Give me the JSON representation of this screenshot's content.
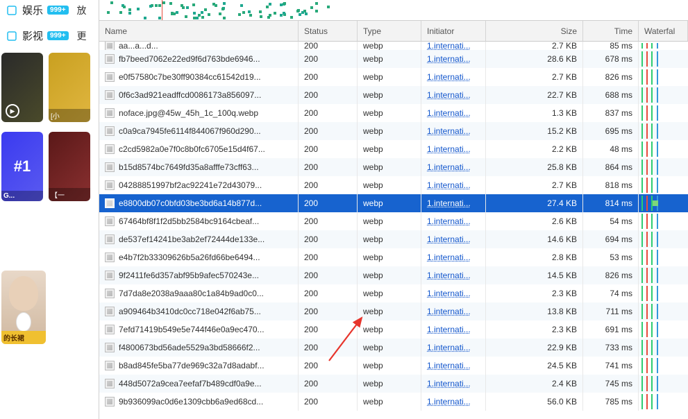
{
  "sidebar": {
    "items": [
      {
        "icon": "entertainment-icon",
        "label": "娱乐",
        "badge": "999+",
        "trail": "放"
      },
      {
        "icon": "film-icon",
        "label": "影视",
        "badge": "999+",
        "trail": "更"
      }
    ],
    "thumbs_row1": [
      {
        "kind": "dark",
        "play": true
      },
      {
        "kind": "yellow",
        "cap": "[小"
      }
    ],
    "thumbs_row2": [
      {
        "kind": "blue",
        "text": "#1",
        "cap": "G..."
      },
      {
        "kind": "red",
        "cap": "【一"
      }
    ],
    "thumb_person": {
      "cap": "的长裙"
    }
  },
  "headers": {
    "name": "Name",
    "status": "Status",
    "type": "Type",
    "initiator": "Initiator",
    "size": "Size",
    "time": "Time",
    "waterfall": "Waterfal"
  },
  "rows": [
    {
      "name": "aa...a...d...",
      "status": "200",
      "type": "webp",
      "initiator": "1.internati...",
      "size": "2.7 KB",
      "time": "85 ms",
      "sel": false,
      "partial": true
    },
    {
      "name": "fb7beed7062e22ed9f6d763bde6946...",
      "status": "200",
      "type": "webp",
      "initiator": "1.internati...",
      "size": "28.6 KB",
      "time": "678 ms",
      "sel": false
    },
    {
      "name": "e0f57580c7be30ff90384cc61542d19...",
      "status": "200",
      "type": "webp",
      "initiator": "1.internati...",
      "size": "2.7 KB",
      "time": "826 ms",
      "sel": false
    },
    {
      "name": "0f6c3ad921eadffcd0086173a856097...",
      "status": "200",
      "type": "webp",
      "initiator": "1.internati...",
      "size": "22.7 KB",
      "time": "688 ms",
      "sel": false
    },
    {
      "name": "noface.jpg@45w_45h_1c_100q.webp",
      "status": "200",
      "type": "webp",
      "initiator": "1.internati...",
      "size": "1.3 KB",
      "time": "837 ms",
      "sel": false
    },
    {
      "name": "c0a9ca7945fe6114f844067f960d290...",
      "status": "200",
      "type": "webp",
      "initiator": "1.internati...",
      "size": "15.2 KB",
      "time": "695 ms",
      "sel": false
    },
    {
      "name": "c2cd5982a0e7f0c8b0fc6705e15d4f67...",
      "status": "200",
      "type": "webp",
      "initiator": "1.internati...",
      "size": "2.2 KB",
      "time": "48 ms",
      "sel": false
    },
    {
      "name": "b15d8574bc7649fd35a8afffe73cff63...",
      "status": "200",
      "type": "webp",
      "initiator": "1.internati...",
      "size": "25.8 KB",
      "time": "864 ms",
      "sel": false
    },
    {
      "name": "04288851997bf2ac92241e72d43079...",
      "status": "200",
      "type": "webp",
      "initiator": "1.internati...",
      "size": "2.7 KB",
      "time": "818 ms",
      "sel": false
    },
    {
      "name": "e8800db07c0bfd03be3bd6a14b877d...",
      "status": "200",
      "type": "webp",
      "initiator": "1.internati...",
      "size": "27.4 KB",
      "time": "814 ms",
      "sel": true
    },
    {
      "name": "67464bf8f1f2d5bb2584bc9164cbeaf...",
      "status": "200",
      "type": "webp",
      "initiator": "1.internati...",
      "size": "2.6 KB",
      "time": "54 ms",
      "sel": false
    },
    {
      "name": "de537ef14241be3ab2ef72444de133e...",
      "status": "200",
      "type": "webp",
      "initiator": "1.internati...",
      "size": "14.6 KB",
      "time": "694 ms",
      "sel": false
    },
    {
      "name": "e4b7f2b33309626b5a26fd66be6494...",
      "status": "200",
      "type": "webp",
      "initiator": "1.internati...",
      "size": "2.8 KB",
      "time": "53 ms",
      "sel": false
    },
    {
      "name": "9f2411fe6d357abf95b9afec570243e...",
      "status": "200",
      "type": "webp",
      "initiator": "1.internati...",
      "size": "14.5 KB",
      "time": "826 ms",
      "sel": false
    },
    {
      "name": "7d7da8e2038a9aaa80c1a84b9ad0c0...",
      "status": "200",
      "type": "webp",
      "initiator": "1.internati...",
      "size": "2.3 KB",
      "time": "74 ms",
      "sel": false
    },
    {
      "name": "a909464b3410dc0cc718e042f6ab75...",
      "status": "200",
      "type": "webp",
      "initiator": "1.internati...",
      "size": "13.8 KB",
      "time": "711 ms",
      "sel": false
    },
    {
      "name": "7efd71419b549e5e744f46e0a9ec470...",
      "status": "200",
      "type": "webp",
      "initiator": "1.internati...",
      "size": "2.3 KB",
      "time": "691 ms",
      "sel": false
    },
    {
      "name": "f4800673bd56ade5529a3bd58666f2...",
      "status": "200",
      "type": "webp",
      "initiator": "1.internati...",
      "size": "22.9 KB",
      "time": "733 ms",
      "sel": false
    },
    {
      "name": "b8ad845fe5ba77de969c32a7d8adabf...",
      "status": "200",
      "type": "webp",
      "initiator": "1.internati...",
      "size": "24.5 KB",
      "time": "741 ms",
      "sel": false
    },
    {
      "name": "448d5072a9cea7eefaf7b489cdf0a9e...",
      "status": "200",
      "type": "webp",
      "initiator": "1.internati...",
      "size": "2.4 KB",
      "time": "745 ms",
      "sel": false
    },
    {
      "name": "9b936099ac0d6e1309cbb6a9ed68cd...",
      "status": "200",
      "type": "webp",
      "initiator": "1.internati...",
      "size": "56.0 KB",
      "time": "785 ms",
      "sel": false
    }
  ]
}
